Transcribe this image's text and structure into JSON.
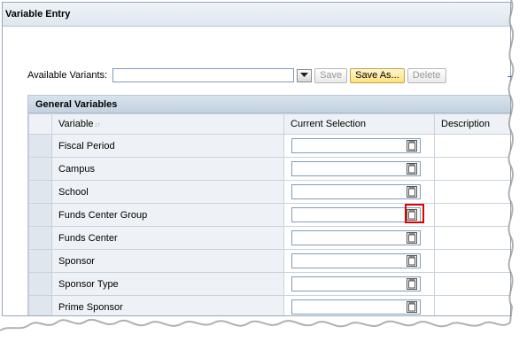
{
  "window": {
    "title": "Variable Entry"
  },
  "variants": {
    "label": "Available Variants:",
    "value": "",
    "buttons": {
      "save": "Save",
      "save_as": "Save As...",
      "delete": "Delete"
    }
  },
  "general_variables": {
    "title": "General Variables",
    "columns": {
      "variable": "Variable",
      "current_selection": "Current Selection",
      "description": "Description"
    },
    "rows": [
      {
        "variable": "Fiscal Period",
        "value": ""
      },
      {
        "variable": "Campus",
        "value": ""
      },
      {
        "variable": "School",
        "value": ""
      },
      {
        "variable": "Funds Center Group",
        "value": "",
        "highlighted": true
      },
      {
        "variable": "Funds Center",
        "value": ""
      },
      {
        "variable": "Sponsor",
        "value": ""
      },
      {
        "variable": "Sponsor Type",
        "value": ""
      },
      {
        "variable": "Prime Sponsor",
        "value": ""
      }
    ]
  },
  "icons": {
    "dropdown": "triangle-down-icon",
    "value_help": "multiple-selection-icon",
    "sort": "sort-icon"
  },
  "colors": {
    "highlight": "#e00000",
    "header_bg": "#c9d7e4",
    "active_button": "#ffe17c"
  }
}
